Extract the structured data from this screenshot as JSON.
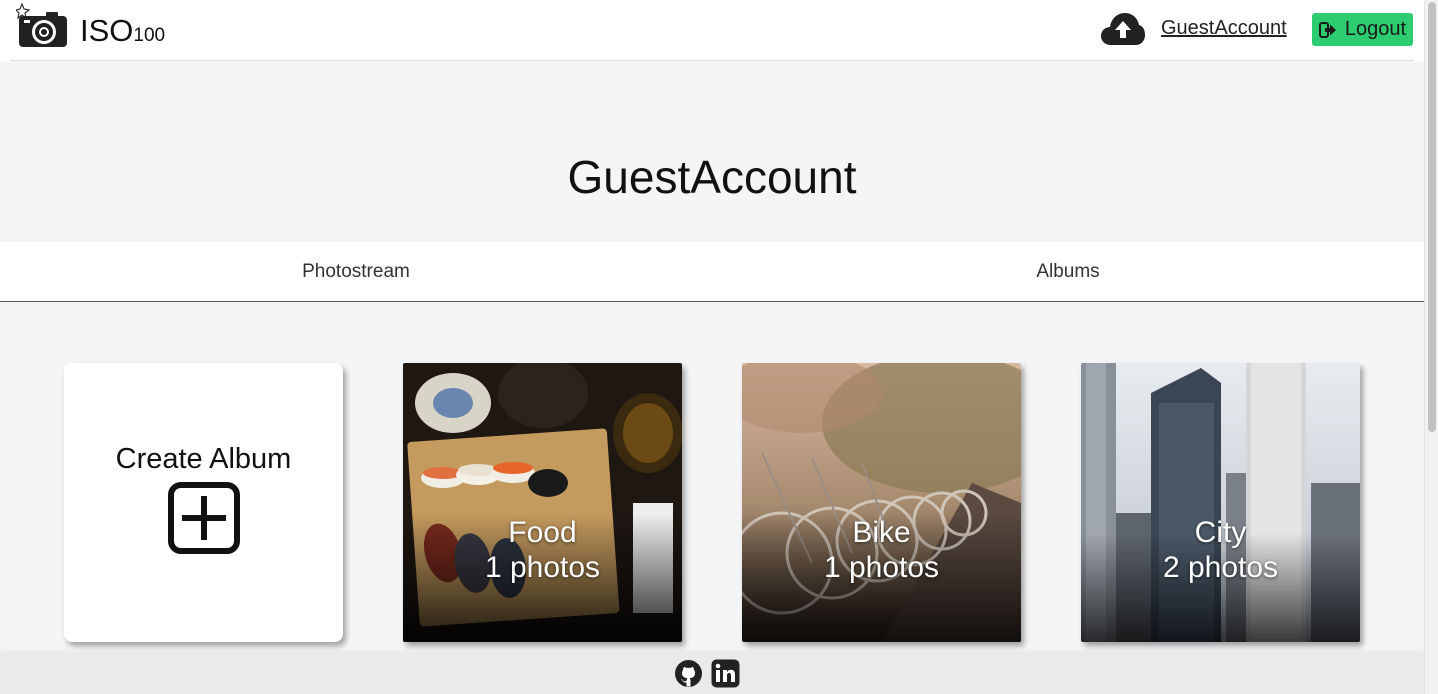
{
  "header": {
    "logo_text": "ISO",
    "logo_sub": "100",
    "account_name": "GuestAccount",
    "logout_label": "Logout",
    "logout_color": "#2ecc71"
  },
  "profile": {
    "title": "GuestAccount"
  },
  "tabs": [
    {
      "label": "Photostream"
    },
    {
      "label": "Albums"
    }
  ],
  "albums": {
    "create_label": "Create Album",
    "items": [
      {
        "name": "Food",
        "count": "1 photos"
      },
      {
        "name": "Bike",
        "count": "1 photos"
      },
      {
        "name": "City",
        "count": "2 photos"
      }
    ]
  },
  "footer": {
    "icons": [
      "github-icon",
      "linkedin-icon"
    ]
  },
  "icons": {
    "logo": "camera-icon",
    "upload": "cloud-upload-icon",
    "logout": "sign-out-icon",
    "create": "plus-square-icon"
  }
}
